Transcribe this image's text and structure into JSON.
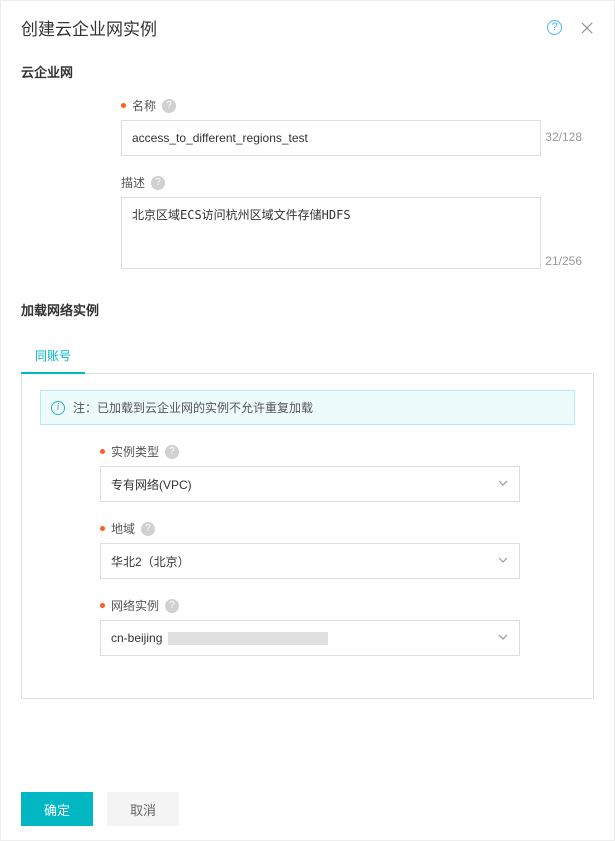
{
  "header": {
    "title": "创建云企业网实例"
  },
  "section1": {
    "title": "云企业网",
    "name_label": "名称",
    "name_value": "access_to_different_regions_test",
    "name_counter": "32/128",
    "desc_label": "描述",
    "desc_value": "北京区域ECS访问杭州区域文件存储HDFS",
    "desc_counter": "21/256"
  },
  "section2": {
    "title": "加载网络实例",
    "tab_same_account": "同账号",
    "info_note": "注：已加载到云企业网的实例不允许重复加载",
    "instance_type_label": "实例类型",
    "instance_type_value": "专有网络(VPC)",
    "region_label": "地域",
    "region_value": "华北2（北京）",
    "net_instance_label": "网络实例",
    "net_instance_value": "cn-beijing"
  },
  "footer": {
    "ok": "确定",
    "cancel": "取消"
  }
}
